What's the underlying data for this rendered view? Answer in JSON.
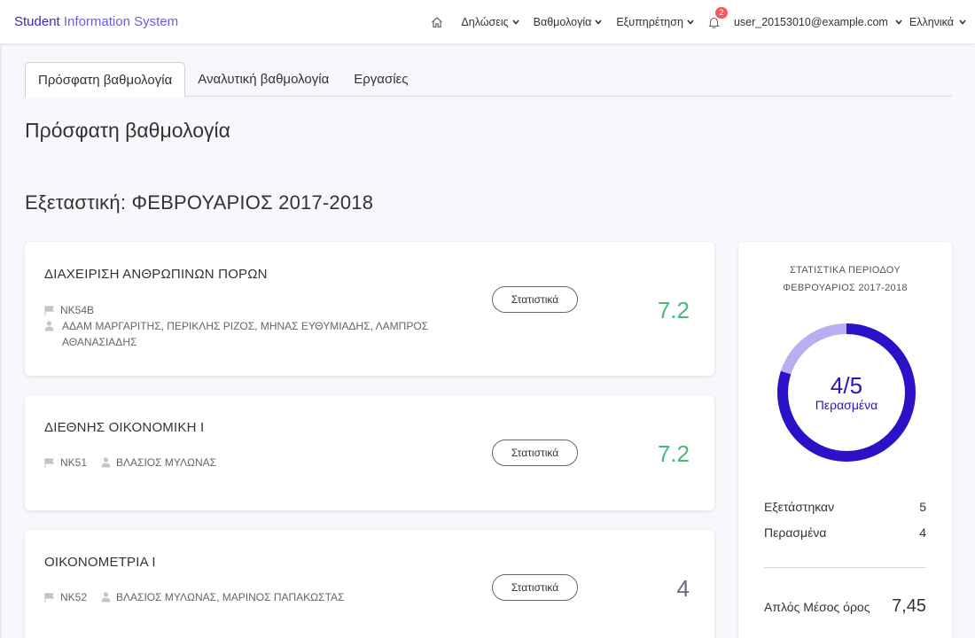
{
  "brand": {
    "part1": "Student",
    "part2": "Information System"
  },
  "nav": {
    "declarations": "Δηλώσεις",
    "grades": "Βαθμολογία",
    "service": "Εξυπηρέτηση",
    "notifications_count": "2",
    "user": "user_20153010@example.com",
    "language": "Ελληνικά"
  },
  "tabs": [
    {
      "label": "Πρόσφατη βαθμολογία",
      "active": true
    },
    {
      "label": "Αναλυτική βαθμολογία",
      "active": false
    },
    {
      "label": "Εργασίες",
      "active": false
    }
  ],
  "page_title": "Πρόσφατη βαθμολογία",
  "period_title": "Εξεταστική: ΦΕΒΡΟΥΑΡΙΟΣ 2017-2018",
  "stats_button_label": "Στατιστικά",
  "courses": [
    {
      "name": "ΔΙΑΧΕΙΡΙΣΗ ΑΝΘΡΩΠΙΝΩΝ ΠΟΡΩΝ",
      "code": "ΝΚ54Β",
      "instructors": "ΑΔΑΜ ΜΑΡΓΑΡΙΤΗΣ, ΠΕΡΙΚΛΗΣ ΡΙΖΟΣ, ΜΗΝΑΣ ΕΥΘΥΜΙΑΔΗΣ, ΛΑΜΠΡΟΣ ΑΘΑΝΑΣΙΑΔΗΣ",
      "grade": "7.2",
      "passed": true
    },
    {
      "name": "ΔΙΕΘΝΗΣ ΟΙΚΟΝΟΜΙΚΗ Ι",
      "code": "ΝΚ51",
      "instructors": "ΒΛΑΣΙΟΣ ΜΥΛΩΝΑΣ",
      "grade": "7.2",
      "passed": true
    },
    {
      "name": "ΟΙΚΟΝΟΜΕΤΡΙΑ Ι",
      "code": "ΝΚ52",
      "instructors": "ΒΛΑΣΙΟΣ ΜΥΛΩΝΑΣ, ΜΑΡΙΝΟΣ ΠΑΠΑΚΩΣΤΑΣ",
      "grade": "4",
      "passed": false
    }
  ],
  "stats": {
    "heading_line1": "ΣΤΑΤΙΣΤΙΚΑ ΠΕΡΙΟΔΟΥ",
    "heading_line2": "ΦΕΒΡΟΥΑΡΙΟΣ 2017-2018",
    "ratio": "4/5",
    "ratio_label": "Περασμένα",
    "passed_fraction": 0.8,
    "examined_label": "Εξετάστηκαν",
    "examined_value": "5",
    "passed_label": "Περασμένα",
    "passed_value": "4",
    "avg_label": "Απλός Μέσος όρος",
    "avg_value": "7,45"
  },
  "colors": {
    "accent": "#2b12c9",
    "donut_rest": "#b9aef2",
    "pass": "#49b97a",
    "fail": "#666d7a",
    "badge": "#f15b5b"
  }
}
